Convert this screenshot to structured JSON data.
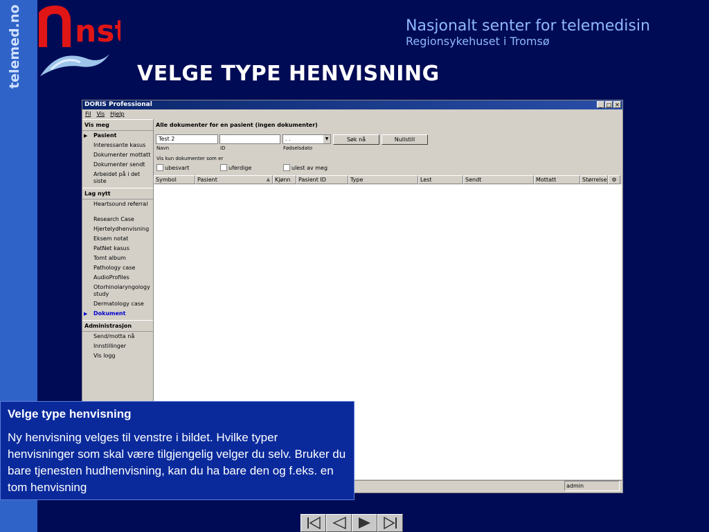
{
  "site_vertical": "telemed.no",
  "logo_text": "nst",
  "org": {
    "line1": "Nasjonalt senter for telemedisin",
    "line2": "Regionsykehuset i Tromsø"
  },
  "slide_title": "VELGE TYPE HENVISNING",
  "window": {
    "title": "DORIS Professional",
    "menu": [
      "Fil",
      "Vis",
      "Hjelp"
    ],
    "left_sections": [
      {
        "title": "Vis meg",
        "items": [
          "Pasient",
          "Interessante kasus",
          "Dokumenter mottatt",
          "Dokumenter sendt",
          "Arbeidet på i det siste"
        ]
      },
      {
        "title": "Lag nytt",
        "items": [
          "Heartsound referral",
          "Research Case",
          "Hjertelydhenvisning",
          "Eksem notat",
          "PatNet kasus",
          "Tomt album",
          "Pathology case",
          "AudioProfiles",
          "Otorhinolaryngology study",
          "Dermatology case",
          "Dokument"
        ]
      },
      {
        "title": "Administrasjon",
        "items": [
          "Send/motta nå",
          "Innstillinger",
          "Vis logg"
        ]
      }
    ],
    "main_header": "Alle dokumenter for en pasient  (ingen dokumenter)",
    "search": {
      "name_value": "Test 2",
      "name_label": "Navn",
      "id_value": "",
      "id_label": "ID",
      "dob_value": " .  .",
      "dob_label": "Fødselsdato",
      "search_btn": "Søk nå",
      "reset_btn": "Nullstill"
    },
    "filter_label": "Vis kun dokumenter som er",
    "filters": [
      "ubesvart",
      "uferdige",
      "ulest av meg"
    ],
    "columns": [
      "Symbol",
      "Pasient",
      "Kjønn",
      "Pasient ID",
      "Type",
      "Lest",
      "Sendt",
      "Mottatt",
      "Størrelse"
    ],
    "status_user": "admin"
  },
  "note": {
    "heading": "Velge type henvisning",
    "body": "Ny henvisning velges til venstre i bildet. Hvilke typer henvisninger som skal være tilgjengelig velger du selv. Bruker du bare tjenesten hudhenvisning, kan du ha bare den og f.eks. en tom henvisning"
  }
}
